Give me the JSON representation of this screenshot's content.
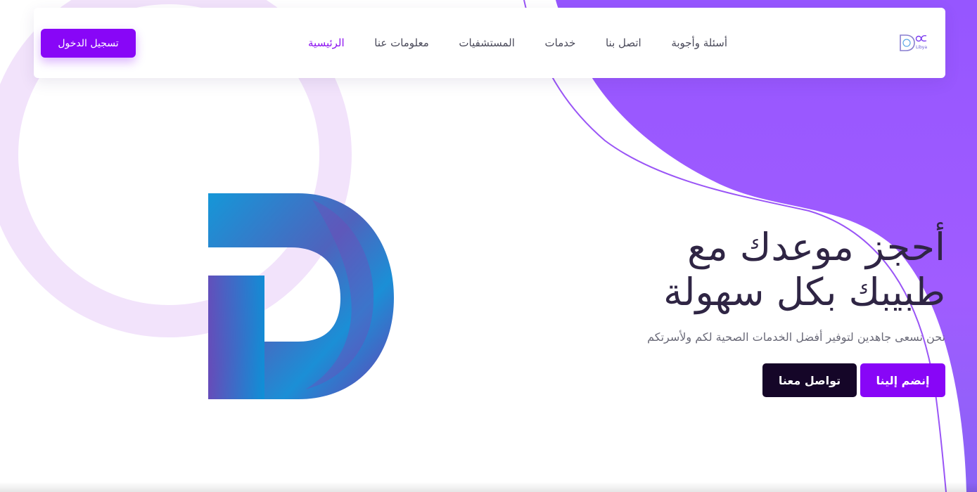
{
  "brand": {
    "logo_icon": "doc-libya-logo",
    "logo_sub": "Libya"
  },
  "nav": {
    "links": [
      {
        "label": "الرئيسية",
        "active": true
      },
      {
        "label": "معلومات عنا",
        "active": false
      },
      {
        "label": "المستشفيات",
        "active": false
      },
      {
        "label": "خدمات",
        "active": false
      },
      {
        "label": "اتصل بنا",
        "active": false
      },
      {
        "label": "أسئلة وأجوبة",
        "active": false
      }
    ],
    "login_label": "تسجيل الدخول"
  },
  "hero": {
    "title_line1": "أحجز موعدك مع",
    "title_line2": "طبيبك بكل سهولة",
    "subtitle": "نحن نسعى جاهدين لتوفير أفضل الخدمات الصحية لكم ولأسرتكم",
    "join_label": "إنضم إلينا",
    "contact_label": "تواصل معنا"
  },
  "colors": {
    "accent": "#8806f7",
    "dark_button": "#150628",
    "blob_purple": "#9b5cff",
    "ring_lavender": "#f2e3fb",
    "heading": "#2f2544"
  }
}
